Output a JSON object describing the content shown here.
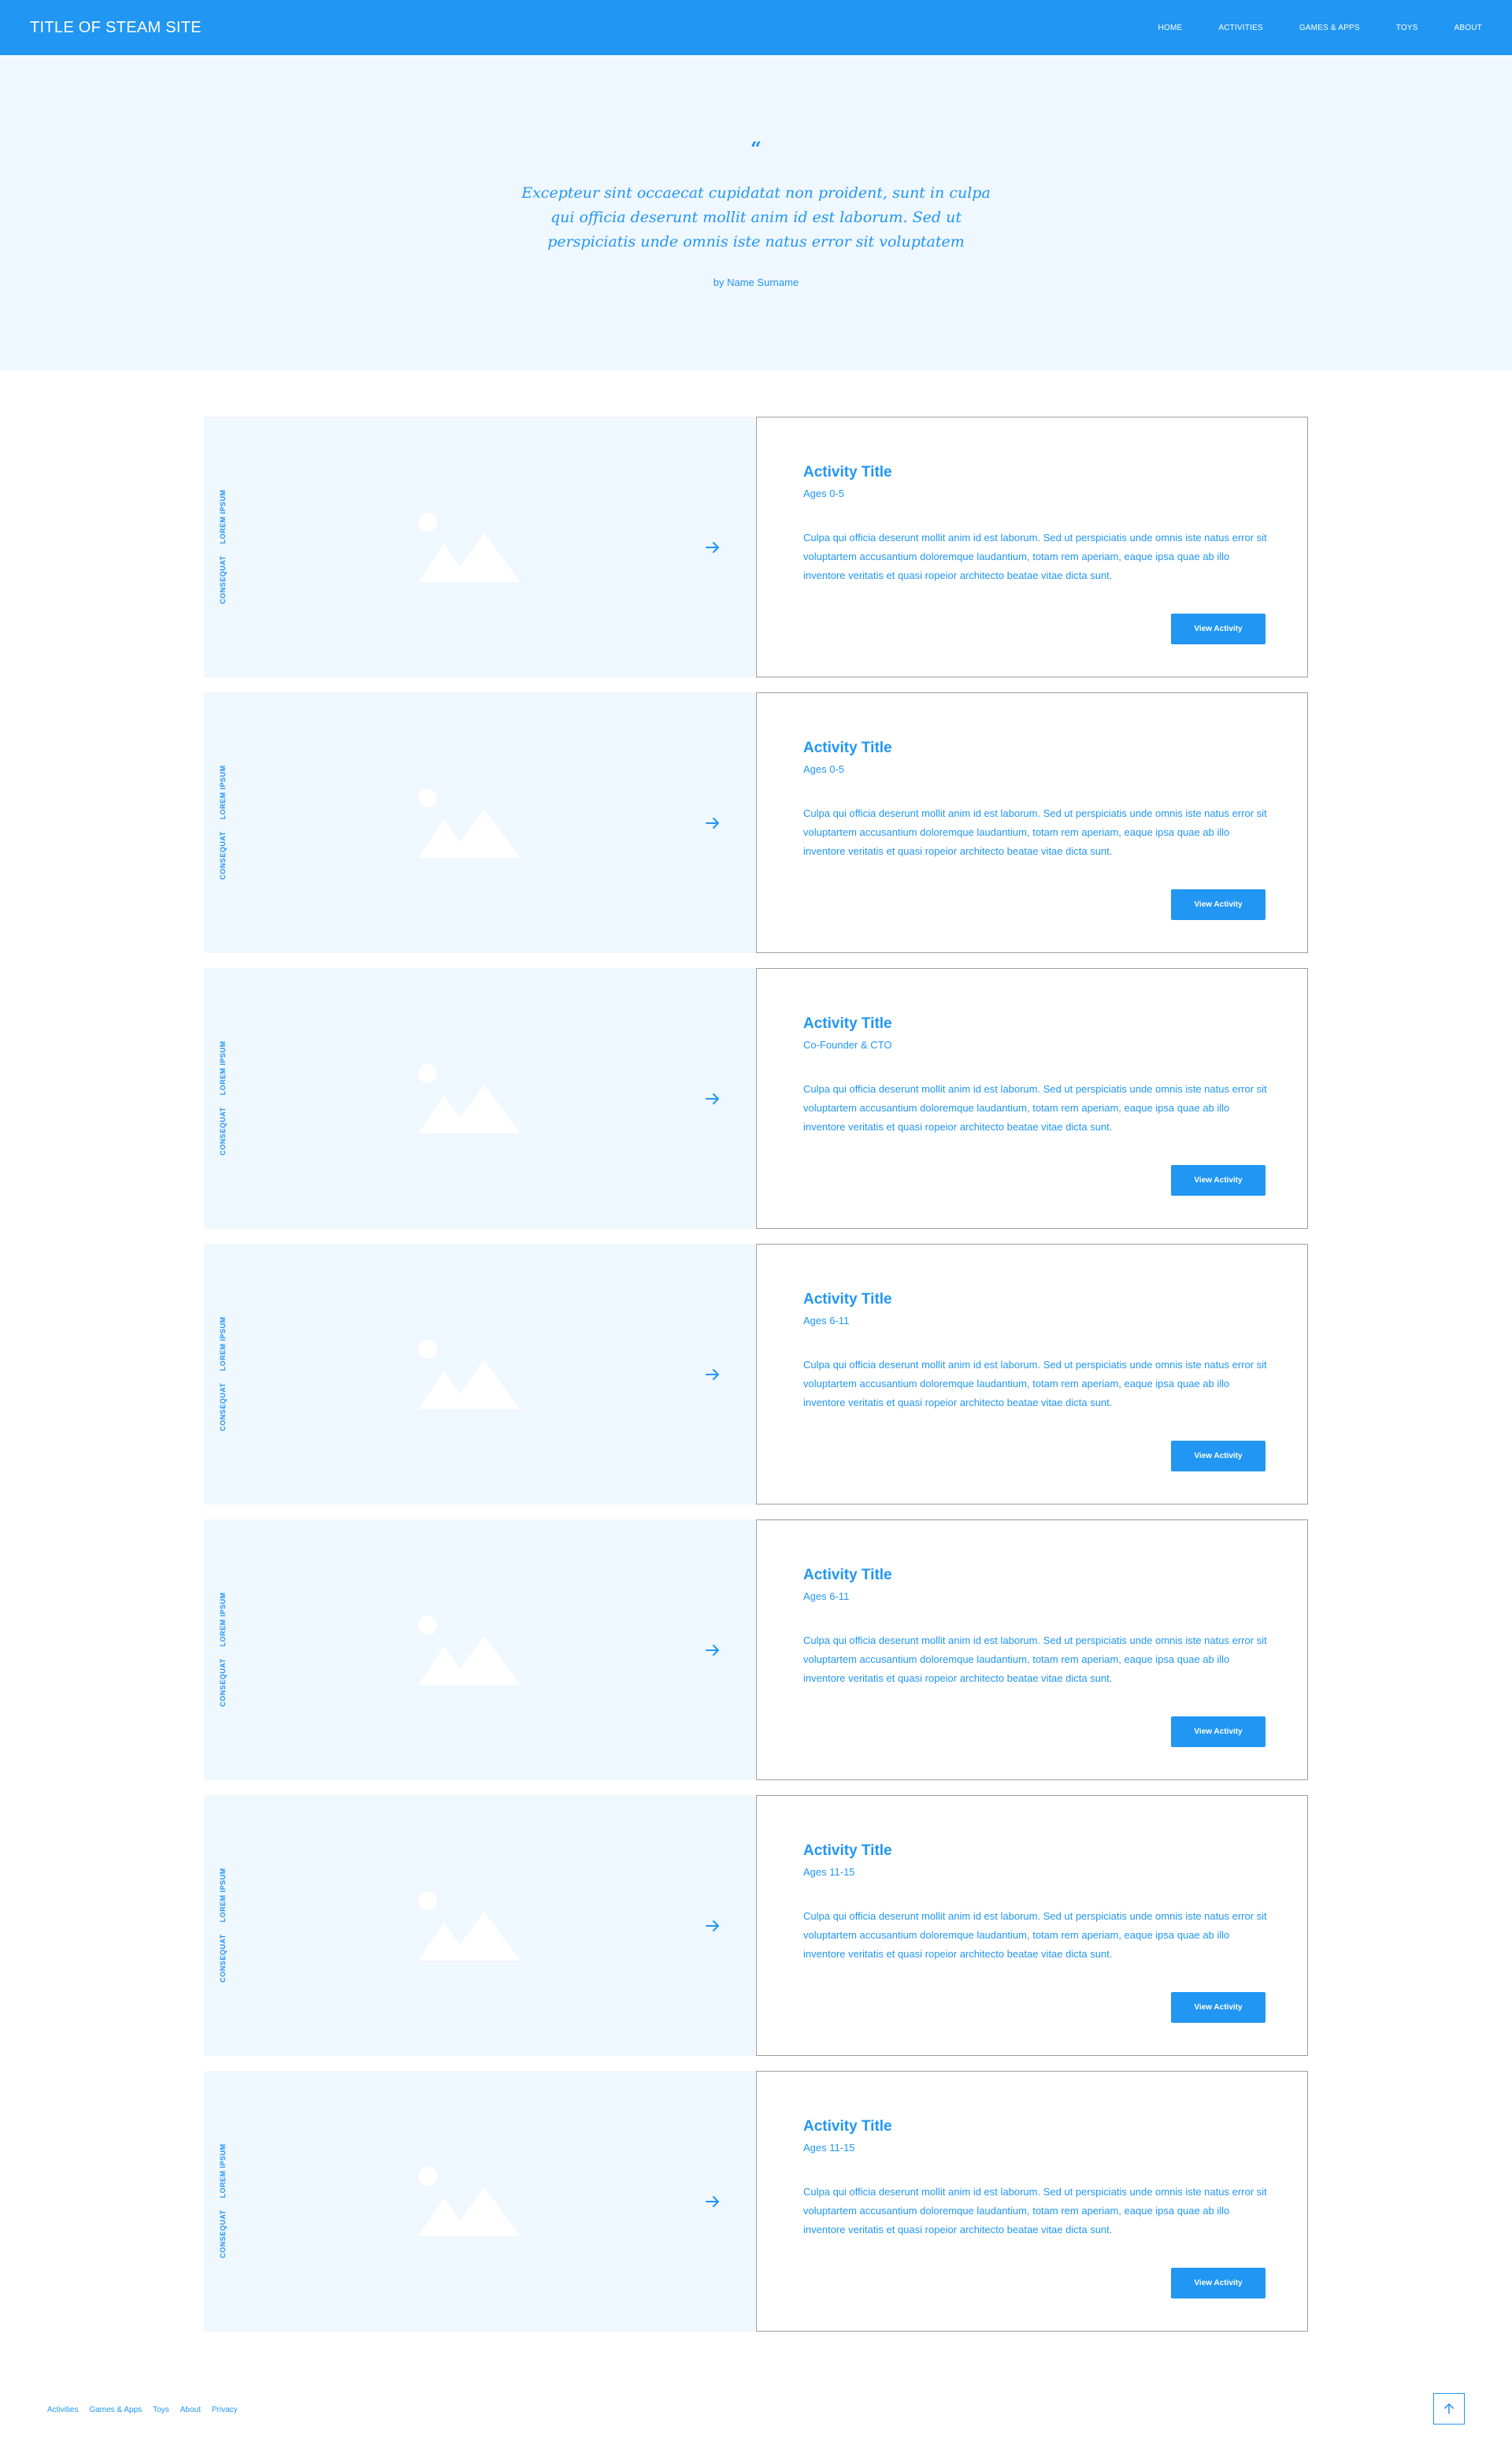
{
  "header": {
    "site_title": "TITLE OF STEAM SITE",
    "nav": [
      "HOME",
      "ACTIVITIES",
      "GAMES & APPS",
      "TOYS",
      "ABOUT"
    ]
  },
  "hero": {
    "quote_mark": "“",
    "quote": "Excepteur sint occaecat cupidatat non proident, sunt in culpa qui officia deserunt mollit anim id est laborum. Sed ut perspiciatis unde omnis iste natus error sit voluptatem",
    "author": "by Name Surname"
  },
  "cards": [
    {
      "label_a": "LOREM IPSUM",
      "label_b": "CONSEQUAT",
      "title": "Activity Title",
      "subtitle": "Ages 0-5",
      "description": "Culpa qui officia deserunt mollit anim id est laborum. Sed ut perspiciatis unde omnis iste natus error sit voluptartem accusantium doloremque laudantium, totam rem aperiam, eaque ipsa quae ab illo inventore veritatis et quasi ropeior architecto beatae vitae dicta sunt.",
      "button": "View Activity"
    },
    {
      "label_a": "LOREM IPSUM",
      "label_b": "CONSEQUAT",
      "title": "Activity Title",
      "subtitle": "Ages 0-5",
      "description": "Culpa qui officia deserunt mollit anim id est laborum. Sed ut perspiciatis unde omnis iste natus error sit voluptartem accusantium doloremque laudantium, totam rem aperiam, eaque ipsa quae ab illo inventore veritatis et quasi ropeior architecto beatae vitae dicta sunt.",
      "button": "View Activity"
    },
    {
      "label_a": "LOREM IPSUM",
      "label_b": "CONSEQUAT",
      "title": "Activity Title",
      "subtitle": "Co-Founder & CTO",
      "description": "Culpa qui officia deserunt mollit anim id est laborum. Sed ut perspiciatis unde omnis iste natus error sit voluptartem accusantium doloremque laudantium, totam rem aperiam, eaque ipsa quae ab illo inventore veritatis et quasi ropeior architecto beatae vitae dicta sunt.",
      "button": "View Activity"
    },
    {
      "label_a": "LOREM IPSUM",
      "label_b": "CONSEQUAT",
      "title": "Activity Title",
      "subtitle": "Ages 6-11",
      "description": "Culpa qui officia deserunt mollit anim id est laborum. Sed ut perspiciatis unde omnis iste natus error sit voluptartem accusantium doloremque laudantium, totam rem aperiam, eaque ipsa quae ab illo inventore veritatis et quasi ropeior architecto beatae vitae dicta sunt.",
      "button": "View Activity"
    },
    {
      "label_a": "LOREM IPSUM",
      "label_b": "CONSEQUAT",
      "title": "Activity Title",
      "subtitle": "Ages 6-11",
      "description": "Culpa qui officia deserunt mollit anim id est laborum. Sed ut perspiciatis unde omnis iste natus error sit voluptartem accusantium doloremque laudantium, totam rem aperiam, eaque ipsa quae ab illo inventore veritatis et quasi ropeior architecto beatae vitae dicta sunt.",
      "button": "View Activity"
    },
    {
      "label_a": "LOREM IPSUM",
      "label_b": "CONSEQUAT",
      "title": "Activity Title",
      "subtitle": "Ages 11-15",
      "description": "Culpa qui officia deserunt mollit anim id est laborum. Sed ut perspiciatis unde omnis iste natus error sit voluptartem accusantium doloremque laudantium, totam rem aperiam, eaque ipsa quae ab illo inventore veritatis et quasi ropeior architecto beatae vitae dicta sunt.",
      "button": "View Activity"
    },
    {
      "label_a": "LOREM IPSUM",
      "label_b": "CONSEQUAT",
      "title": "Activity Title",
      "subtitle": "Ages 11-15",
      "description": "Culpa qui officia deserunt mollit anim id est laborum. Sed ut perspiciatis unde omnis iste natus error sit voluptartem accusantium doloremque laudantium, totam rem aperiam, eaque ipsa quae ab illo inventore veritatis et quasi ropeior architecto beatae vitae dicta sunt.",
      "button": "View Activity"
    }
  ],
  "footer": {
    "links": [
      "Activities",
      "Games & Apps",
      "Toys",
      "About",
      "Privacy"
    ]
  },
  "icons": {
    "card_image": "image-placeholder-icon",
    "card_arrow": "arrow-right-icon",
    "back_to_top": "arrow-up-icon"
  },
  "colors": {
    "accent": "#2196F3",
    "panel": "#EFF7FF",
    "border": "#9E9E9E",
    "background": "#FFFFFF"
  }
}
